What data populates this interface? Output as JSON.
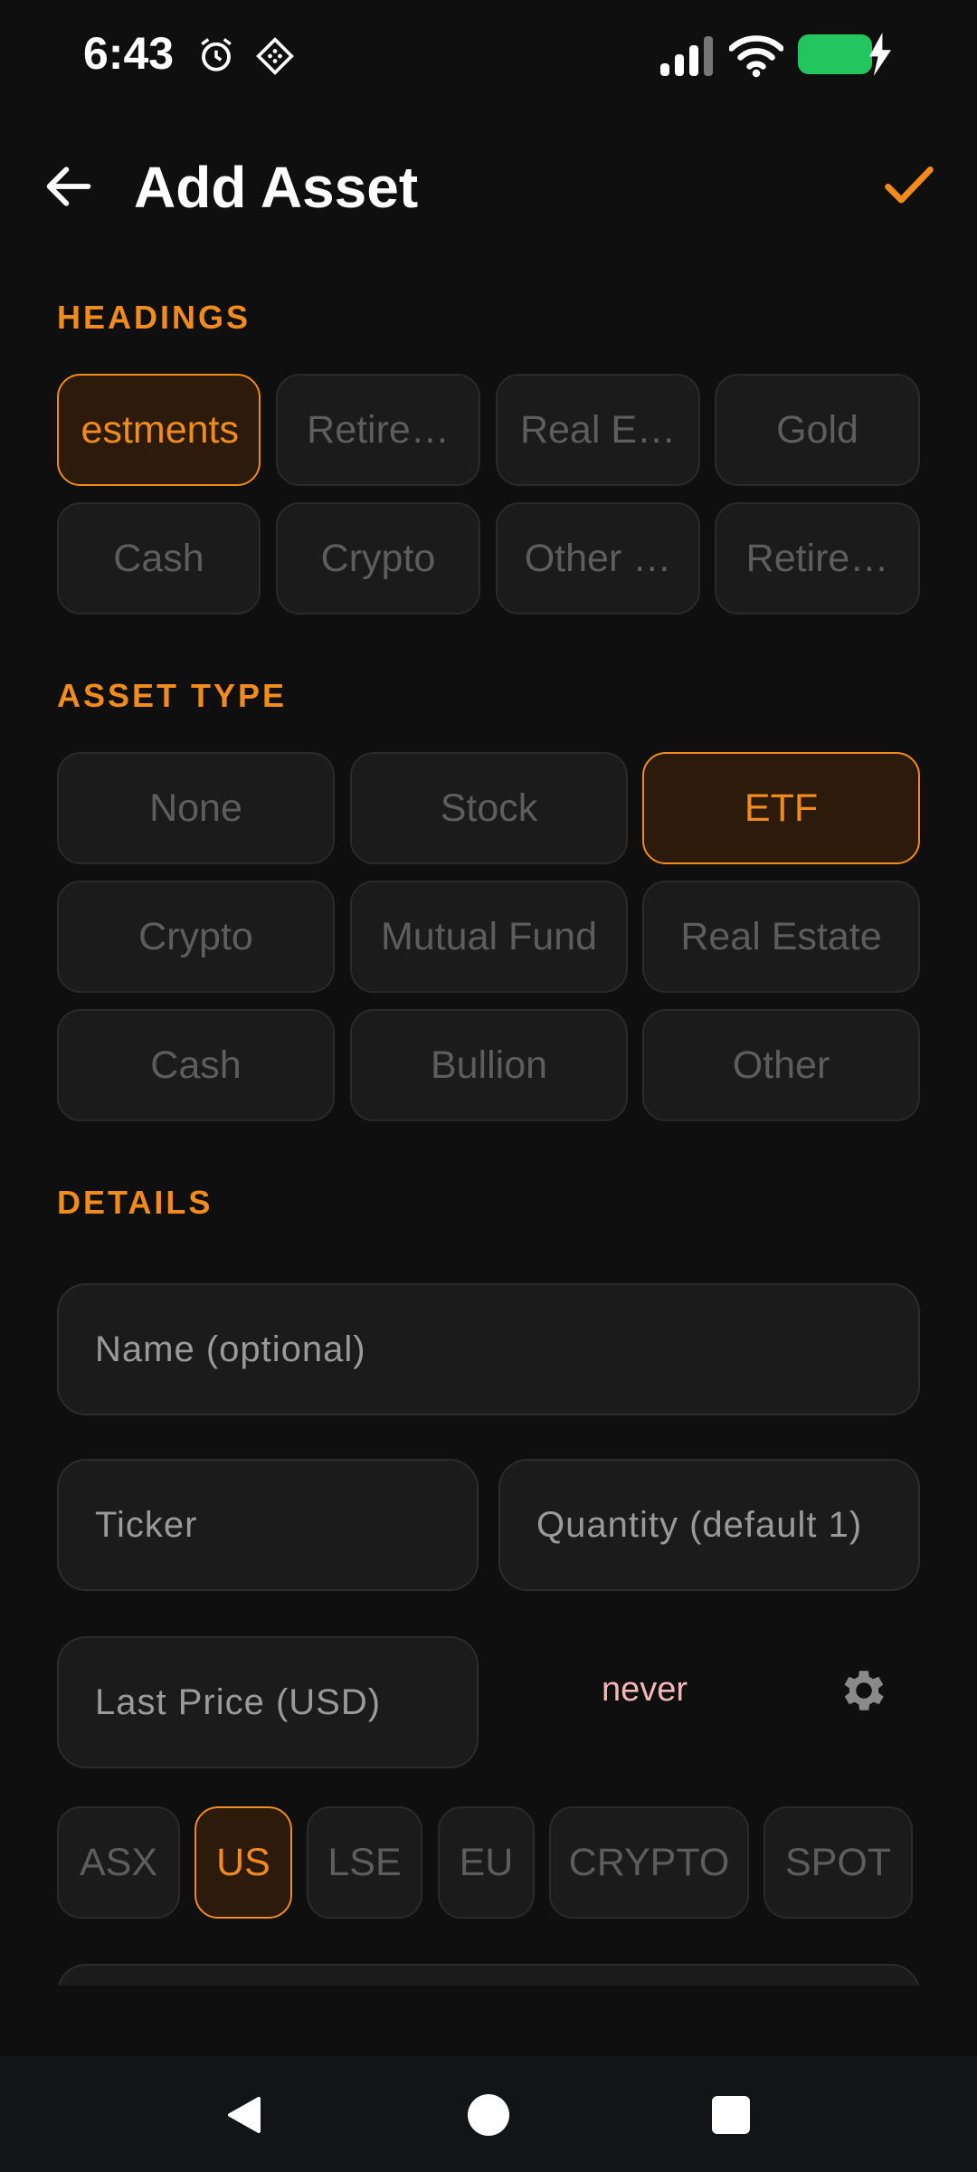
{
  "status_bar": {
    "time": "6:43",
    "icons": [
      "alarm-icon",
      "vpn-icon",
      "signal-icon",
      "wifi-icon",
      "battery-charging-icon"
    ],
    "battery_color": "#22c55e"
  },
  "header": {
    "title": "Add Asset",
    "back_icon": "arrow-left-icon",
    "confirm_icon": "check-icon",
    "accent_color": "#f08b1c"
  },
  "headings": {
    "label": "HEADINGS",
    "items": [
      {
        "label": "estments",
        "selected": true
      },
      {
        "label": "Retire…",
        "selected": false
      },
      {
        "label": "Real E…",
        "selected": false
      },
      {
        "label": "Gold",
        "selected": false
      },
      {
        "label": "Cash",
        "selected": false
      },
      {
        "label": "Crypto",
        "selected": false
      },
      {
        "label": "Other …",
        "selected": false
      },
      {
        "label": "Retire…",
        "selected": false
      }
    ]
  },
  "asset_type": {
    "label": "ASSET TYPE",
    "items": [
      {
        "label": "None",
        "selected": false
      },
      {
        "label": "Stock",
        "selected": false
      },
      {
        "label": "ETF",
        "selected": true
      },
      {
        "label": "Crypto",
        "selected": false
      },
      {
        "label": "Mutual Fund",
        "selected": false
      },
      {
        "label": "Real Estate",
        "selected": false
      },
      {
        "label": "Cash",
        "selected": false
      },
      {
        "label": "Bullion",
        "selected": false
      },
      {
        "label": "Other",
        "selected": false
      }
    ]
  },
  "details": {
    "label": "DETAILS",
    "name_placeholder": "Name (optional)",
    "ticker_placeholder": "Ticker",
    "quantity_placeholder": "Quantity (default 1)",
    "last_price_placeholder": "Last Price (USD)",
    "last_updated": "never",
    "settings_icon": "gear-icon"
  },
  "exchanges": {
    "items": [
      {
        "label": "ASX",
        "selected": false
      },
      {
        "label": "US",
        "selected": true
      },
      {
        "label": "LSE",
        "selected": false
      },
      {
        "label": "EU",
        "selected": false
      },
      {
        "label": "CRYPTO",
        "selected": false
      },
      {
        "label": "SPOT",
        "selected": false
      }
    ]
  },
  "nav_bar": {
    "icons": [
      "back-triangle-icon",
      "home-circle-icon",
      "recents-square-icon"
    ]
  }
}
